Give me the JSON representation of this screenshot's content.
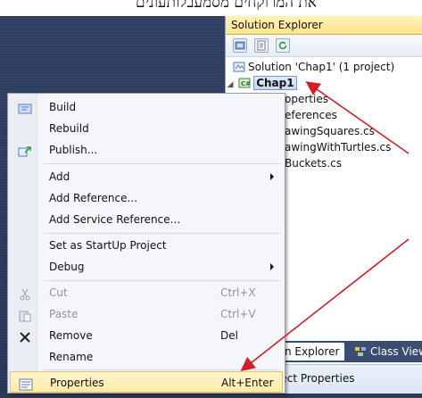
{
  "banner": {
    "text": "את המרוקחים מסמעבלותעונים"
  },
  "solution_explorer": {
    "title": "Solution Explorer",
    "tree": {
      "solution": "Solution 'Chap1' (1 project)",
      "project": "Chap1",
      "items": [
        "operties",
        "eferences",
        "awingSquares.cs",
        "awingWithTurtles.cs",
        "Buckets.cs"
      ]
    },
    "tabs": {
      "active": "n Explorer",
      "inactive": "Class View"
    },
    "properties_title": "ject Properties"
  },
  "context_menu": {
    "items": [
      {
        "label": "Build",
        "icon": "build-icon"
      },
      {
        "label": "Rebuild"
      },
      {
        "label": "Publish...",
        "icon": "publish-icon"
      },
      {
        "label": "Add",
        "submenu": true
      },
      {
        "label": "Add Reference..."
      },
      {
        "label": "Add Service Reference..."
      },
      {
        "label": "Set as StartUp Project"
      },
      {
        "label": "Debug",
        "submenu": true
      },
      {
        "label": "Cut",
        "shortcut": "Ctrl+X",
        "icon": "cut-icon",
        "disabled": true
      },
      {
        "label": "Paste",
        "shortcut": "Ctrl+V",
        "icon": "paste-icon",
        "disabled": true
      },
      {
        "label": "Remove",
        "shortcut": "Del",
        "icon": "remove-icon"
      },
      {
        "label": "Rename"
      },
      {
        "label": "Properties",
        "shortcut": "Alt+Enter",
        "icon": "properties-icon",
        "highlighted": true
      }
    ]
  },
  "colors": {
    "callout_arrow": "#d0202a",
    "menu_highlight": "#ffe9a6",
    "vs_background": "#2b3a55"
  }
}
